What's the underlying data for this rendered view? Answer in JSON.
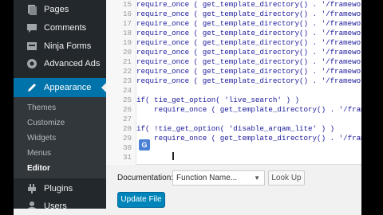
{
  "sidebar": {
    "items": [
      {
        "label": "Pages",
        "icon": "pages-icon"
      },
      {
        "label": "Comments",
        "icon": "comments-icon"
      },
      {
        "label": "Ninja Forms",
        "icon": "ninja-forms-icon"
      },
      {
        "label": "Advanced Ads",
        "icon": "advanced-ads-icon"
      },
      {
        "label": "Appearance",
        "icon": "appearance-icon",
        "active": true
      },
      {
        "label": "Plugins",
        "icon": "plugins-icon"
      },
      {
        "label": "Users",
        "icon": "users-icon"
      }
    ],
    "submenu": [
      {
        "label": "Themes"
      },
      {
        "label": "Customize"
      },
      {
        "label": "Widgets"
      },
      {
        "label": "Menus"
      },
      {
        "label": "Editor",
        "current": true
      }
    ]
  },
  "editor": {
    "lines": [
      {
        "num": "15",
        "code": "require_once ( get_template_directory() . '/framework/funct"
      },
      {
        "num": "16",
        "code": "require_once ( get_template_directory() . '/framework/funct"
      },
      {
        "num": "17",
        "code": "require_once ( get_template_directory() . '/framework/funct"
      },
      {
        "num": "18",
        "code": "require_once ( get_template_directory() . '/framework/funct"
      },
      {
        "num": "19",
        "code": "require_once ( get_template_directory() . '/framework/funct"
      },
      {
        "num": "20",
        "code": "require_once ( get_template_directory() . '/framework/funct"
      },
      {
        "num": "21",
        "code": "require_once ( get_template_directory() . '/framework/widge"
      },
      {
        "num": "22",
        "code": "require_once ( get_template_directory() . '/framework/admin"
      },
      {
        "num": "23",
        "code": "require_once ( get_template_directory() . '/framework/short"
      },
      {
        "num": "24",
        "code": ""
      },
      {
        "num": "25",
        "code": "if( tie_get_option( 'live_search' ) )"
      },
      {
        "num": "26",
        "code": "    require_once ( get_template_directory() . '/framework/f"
      },
      {
        "num": "27",
        "code": ""
      },
      {
        "num": "28",
        "code": "if( !tie_get_option( 'disable_arqam_lite' ) )"
      },
      {
        "num": "29",
        "code": "    require_once ( get_template_directory() . '/framework/f"
      },
      {
        "num": "30",
        "code": ""
      },
      {
        "num": "31",
        "code": ""
      }
    ]
  },
  "documentation": {
    "label": "Documentation:",
    "select_value": "Function Name...",
    "lookup_label": "Look Up"
  },
  "update_button": "Update File",
  "colors": {
    "sidebar_bg": "#23282d",
    "active_bg": "#0073aa",
    "primary_button": "#0085ba"
  }
}
